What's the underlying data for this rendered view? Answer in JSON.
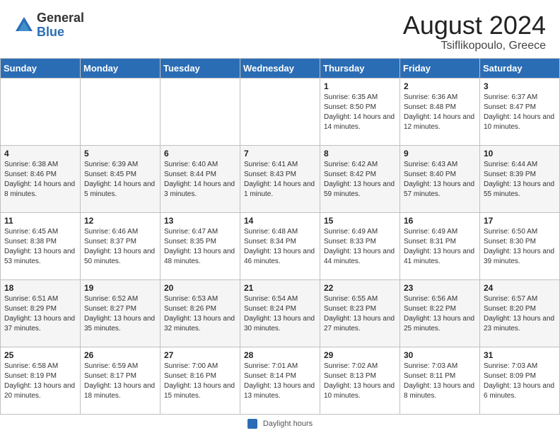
{
  "header": {
    "logo_general": "General",
    "logo_blue": "Blue",
    "month_year": "August 2024",
    "location": "Tsiflikopoulo, Greece"
  },
  "weekdays": [
    "Sunday",
    "Monday",
    "Tuesday",
    "Wednesday",
    "Thursday",
    "Friday",
    "Saturday"
  ],
  "weeks": [
    [
      {
        "day": "",
        "info": ""
      },
      {
        "day": "",
        "info": ""
      },
      {
        "day": "",
        "info": ""
      },
      {
        "day": "",
        "info": ""
      },
      {
        "day": "1",
        "info": "Sunrise: 6:35 AM\nSunset: 8:50 PM\nDaylight: 14 hours and 14 minutes."
      },
      {
        "day": "2",
        "info": "Sunrise: 6:36 AM\nSunset: 8:48 PM\nDaylight: 14 hours and 12 minutes."
      },
      {
        "day": "3",
        "info": "Sunrise: 6:37 AM\nSunset: 8:47 PM\nDaylight: 14 hours and 10 minutes."
      }
    ],
    [
      {
        "day": "4",
        "info": "Sunrise: 6:38 AM\nSunset: 8:46 PM\nDaylight: 14 hours and 8 minutes."
      },
      {
        "day": "5",
        "info": "Sunrise: 6:39 AM\nSunset: 8:45 PM\nDaylight: 14 hours and 5 minutes."
      },
      {
        "day": "6",
        "info": "Sunrise: 6:40 AM\nSunset: 8:44 PM\nDaylight: 14 hours and 3 minutes."
      },
      {
        "day": "7",
        "info": "Sunrise: 6:41 AM\nSunset: 8:43 PM\nDaylight: 14 hours and 1 minute."
      },
      {
        "day": "8",
        "info": "Sunrise: 6:42 AM\nSunset: 8:42 PM\nDaylight: 13 hours and 59 minutes."
      },
      {
        "day": "9",
        "info": "Sunrise: 6:43 AM\nSunset: 8:40 PM\nDaylight: 13 hours and 57 minutes."
      },
      {
        "day": "10",
        "info": "Sunrise: 6:44 AM\nSunset: 8:39 PM\nDaylight: 13 hours and 55 minutes."
      }
    ],
    [
      {
        "day": "11",
        "info": "Sunrise: 6:45 AM\nSunset: 8:38 PM\nDaylight: 13 hours and 53 minutes."
      },
      {
        "day": "12",
        "info": "Sunrise: 6:46 AM\nSunset: 8:37 PM\nDaylight: 13 hours and 50 minutes."
      },
      {
        "day": "13",
        "info": "Sunrise: 6:47 AM\nSunset: 8:35 PM\nDaylight: 13 hours and 48 minutes."
      },
      {
        "day": "14",
        "info": "Sunrise: 6:48 AM\nSunset: 8:34 PM\nDaylight: 13 hours and 46 minutes."
      },
      {
        "day": "15",
        "info": "Sunrise: 6:49 AM\nSunset: 8:33 PM\nDaylight: 13 hours and 44 minutes."
      },
      {
        "day": "16",
        "info": "Sunrise: 6:49 AM\nSunset: 8:31 PM\nDaylight: 13 hours and 41 minutes."
      },
      {
        "day": "17",
        "info": "Sunrise: 6:50 AM\nSunset: 8:30 PM\nDaylight: 13 hours and 39 minutes."
      }
    ],
    [
      {
        "day": "18",
        "info": "Sunrise: 6:51 AM\nSunset: 8:29 PM\nDaylight: 13 hours and 37 minutes."
      },
      {
        "day": "19",
        "info": "Sunrise: 6:52 AM\nSunset: 8:27 PM\nDaylight: 13 hours and 35 minutes."
      },
      {
        "day": "20",
        "info": "Sunrise: 6:53 AM\nSunset: 8:26 PM\nDaylight: 13 hours and 32 minutes."
      },
      {
        "day": "21",
        "info": "Sunrise: 6:54 AM\nSunset: 8:24 PM\nDaylight: 13 hours and 30 minutes."
      },
      {
        "day": "22",
        "info": "Sunrise: 6:55 AM\nSunset: 8:23 PM\nDaylight: 13 hours and 27 minutes."
      },
      {
        "day": "23",
        "info": "Sunrise: 6:56 AM\nSunset: 8:22 PM\nDaylight: 13 hours and 25 minutes."
      },
      {
        "day": "24",
        "info": "Sunrise: 6:57 AM\nSunset: 8:20 PM\nDaylight: 13 hours and 23 minutes."
      }
    ],
    [
      {
        "day": "25",
        "info": "Sunrise: 6:58 AM\nSunset: 8:19 PM\nDaylight: 13 hours and 20 minutes."
      },
      {
        "day": "26",
        "info": "Sunrise: 6:59 AM\nSunset: 8:17 PM\nDaylight: 13 hours and 18 minutes."
      },
      {
        "day": "27",
        "info": "Sunrise: 7:00 AM\nSunset: 8:16 PM\nDaylight: 13 hours and 15 minutes."
      },
      {
        "day": "28",
        "info": "Sunrise: 7:01 AM\nSunset: 8:14 PM\nDaylight: 13 hours and 13 minutes."
      },
      {
        "day": "29",
        "info": "Sunrise: 7:02 AM\nSunset: 8:13 PM\nDaylight: 13 hours and 10 minutes."
      },
      {
        "day": "30",
        "info": "Sunrise: 7:03 AM\nSunset: 8:11 PM\nDaylight: 13 hours and 8 minutes."
      },
      {
        "day": "31",
        "info": "Sunrise: 7:03 AM\nSunset: 8:09 PM\nDaylight: 13 hours and 6 minutes."
      }
    ]
  ],
  "footer": {
    "swatch_label": "Daylight hours"
  }
}
